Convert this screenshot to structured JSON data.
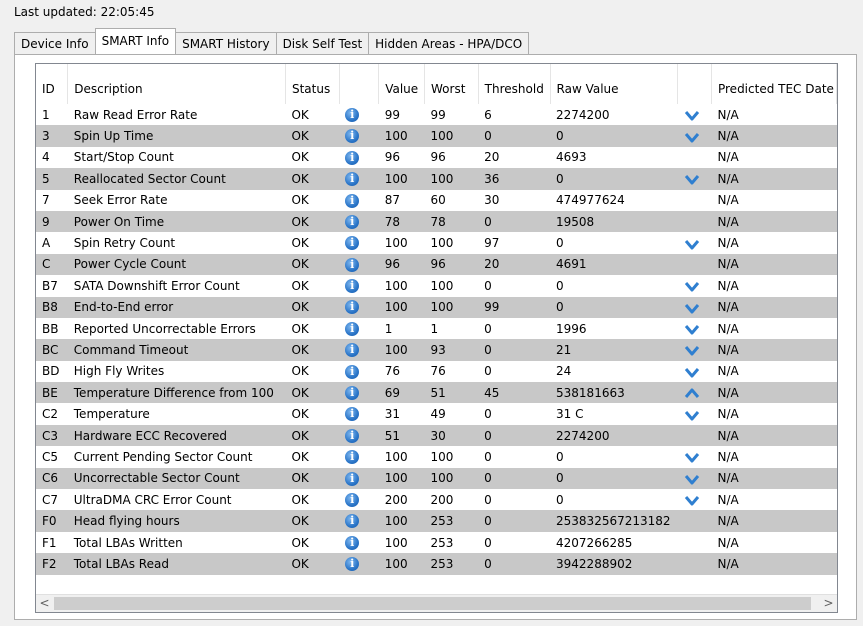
{
  "last_updated": "Last updated: 22:05:45",
  "tabs": [
    {
      "label": "Device Info",
      "active": false
    },
    {
      "label": "SMART Info",
      "active": true
    },
    {
      "label": "SMART History",
      "active": false
    },
    {
      "label": "Disk Self Test",
      "active": false
    },
    {
      "label": "Hidden Areas - HPA/DCO",
      "active": false
    }
  ],
  "table": {
    "headers": {
      "id": "ID",
      "description": "Description",
      "status": "Status",
      "icon": "",
      "value": "Value",
      "worst": "Worst",
      "threshold": "Threshold",
      "raw_value": "Raw Value",
      "trend": "",
      "predicted": "Predicted TEC Date"
    },
    "rows": [
      {
        "id": "1",
        "description": "Raw Read Error Rate",
        "status": "OK",
        "value": "99",
        "worst": "99",
        "threshold": "6",
        "raw": "2274200",
        "trend": "down",
        "predicted": "N/A"
      },
      {
        "id": "3",
        "description": "Spin Up Time",
        "status": "OK",
        "value": "100",
        "worst": "100",
        "threshold": "0",
        "raw": "0",
        "trend": "down",
        "predicted": "N/A"
      },
      {
        "id": "4",
        "description": "Start/Stop Count",
        "status": "OK",
        "value": "96",
        "worst": "96",
        "threshold": "20",
        "raw": "4693",
        "trend": "",
        "predicted": "N/A"
      },
      {
        "id": "5",
        "description": "Reallocated Sector Count",
        "status": "OK",
        "value": "100",
        "worst": "100",
        "threshold": "36",
        "raw": "0",
        "trend": "down",
        "predicted": "N/A"
      },
      {
        "id": "7",
        "description": "Seek Error Rate",
        "status": "OK",
        "value": "87",
        "worst": "60",
        "threshold": "30",
        "raw": "474977624",
        "trend": "",
        "predicted": "N/A"
      },
      {
        "id": "9",
        "description": "Power On Time",
        "status": "OK",
        "value": "78",
        "worst": "78",
        "threshold": "0",
        "raw": "19508",
        "trend": "",
        "predicted": "N/A"
      },
      {
        "id": "A",
        "description": "Spin Retry Count",
        "status": "OK",
        "value": "100",
        "worst": "100",
        "threshold": "97",
        "raw": "0",
        "trend": "down",
        "predicted": "N/A"
      },
      {
        "id": "C",
        "description": "Power Cycle Count",
        "status": "OK",
        "value": "96",
        "worst": "96",
        "threshold": "20",
        "raw": "4691",
        "trend": "",
        "predicted": "N/A"
      },
      {
        "id": "B7",
        "description": "SATA Downshift Error Count",
        "status": "OK",
        "value": "100",
        "worst": "100",
        "threshold": "0",
        "raw": "0",
        "trend": "down",
        "predicted": "N/A"
      },
      {
        "id": "B8",
        "description": "End-to-End error",
        "status": "OK",
        "value": "100",
        "worst": "100",
        "threshold": "99",
        "raw": "0",
        "trend": "down",
        "predicted": "N/A"
      },
      {
        "id": "BB",
        "description": "Reported Uncorrectable Errors",
        "status": "OK",
        "value": "1",
        "worst": "1",
        "threshold": "0",
        "raw": "1996",
        "trend": "down",
        "predicted": "N/A"
      },
      {
        "id": "BC",
        "description": "Command Timeout",
        "status": "OK",
        "value": "100",
        "worst": "93",
        "threshold": "0",
        "raw": "21",
        "trend": "down",
        "predicted": "N/A"
      },
      {
        "id": "BD",
        "description": "High Fly Writes",
        "status": "OK",
        "value": "76",
        "worst": "76",
        "threshold": "0",
        "raw": "24",
        "trend": "down",
        "predicted": "N/A"
      },
      {
        "id": "BE",
        "description": "Temperature Difference from 100",
        "status": "OK",
        "value": "69",
        "worst": "51",
        "threshold": "45",
        "raw": "538181663",
        "trend": "up",
        "predicted": "N/A"
      },
      {
        "id": "C2",
        "description": "Temperature",
        "status": "OK",
        "value": "31",
        "worst": "49",
        "threshold": "0",
        "raw": "31 C",
        "trend": "down",
        "predicted": "N/A"
      },
      {
        "id": "C3",
        "description": "Hardware ECC Recovered",
        "status": "OK",
        "value": "51",
        "worst": "30",
        "threshold": "0",
        "raw": "2274200",
        "trend": "",
        "predicted": "N/A"
      },
      {
        "id": "C5",
        "description": "Current Pending Sector Count",
        "status": "OK",
        "value": "100",
        "worst": "100",
        "threshold": "0",
        "raw": "0",
        "trend": "down",
        "predicted": "N/A"
      },
      {
        "id": "C6",
        "description": "Uncorrectable Sector Count",
        "status": "OK",
        "value": "100",
        "worst": "100",
        "threshold": "0",
        "raw": "0",
        "trend": "down",
        "predicted": "N/A"
      },
      {
        "id": "C7",
        "description": "UltraDMA CRC Error Count",
        "status": "OK",
        "value": "200",
        "worst": "200",
        "threshold": "0",
        "raw": "0",
        "trend": "down",
        "predicted": "N/A"
      },
      {
        "id": "F0",
        "description": "Head flying hours",
        "status": "OK",
        "value": "100",
        "worst": "253",
        "threshold": "0",
        "raw": "253832567213182",
        "trend": "",
        "predicted": "N/A"
      },
      {
        "id": "F1",
        "description": "Total LBAs Written",
        "status": "OK",
        "value": "100",
        "worst": "253",
        "threshold": "0",
        "raw": "4207266285",
        "trend": "",
        "predicted": "N/A"
      },
      {
        "id": "F2",
        "description": "Total LBAs Read",
        "status": "OK",
        "value": "100",
        "worst": "253",
        "threshold": "0",
        "raw": "3942288902",
        "trend": "",
        "predicted": "N/A"
      }
    ]
  },
  "scrollbar": {
    "left_arrow": "<",
    "right_arrow": ">"
  },
  "colors": {
    "alt_row": "#c8c8c8",
    "chevron": "#2f7fd0",
    "info_icon": "#2a75c8"
  }
}
